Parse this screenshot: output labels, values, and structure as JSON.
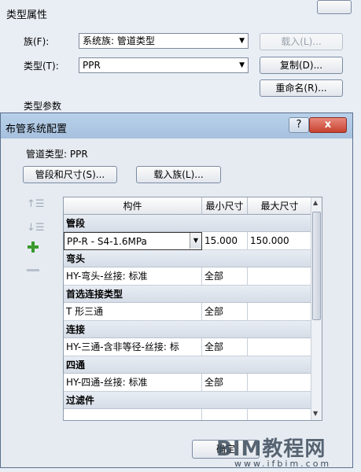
{
  "type_props": {
    "title": "类型属性",
    "family_label": "族(F):",
    "family_value": "系统族: 管道类型",
    "load_button": "载入(L)...",
    "type_label": "类型(T):",
    "type_value": "PPR",
    "duplicate_button": "复制(D)...",
    "rename_button": "重命名(R)...",
    "type_params_label": "类型参数"
  },
  "routing": {
    "title": "布管系统配置",
    "help": "?",
    "close": "x",
    "pipe_type_label": "管道类型: PPR",
    "segments_button": "管段和尺寸(S)...",
    "load_family_button": "载入族(L)...",
    "columns": [
      "构件",
      "最小尺寸",
      "最大尺寸"
    ],
    "rows": [
      {
        "group": "管段"
      },
      {
        "c1": "PP-R - S4-1.6MPa",
        "c2": "15.000",
        "c3": "150.000",
        "dropdown": true
      },
      {
        "group": "弯头"
      },
      {
        "c1": "HY-弯头-丝接: 标准",
        "c2": "全部",
        "c3": ""
      },
      {
        "group": "首选连接类型"
      },
      {
        "c1": "T 形三通",
        "c2": "全部",
        "c3": ""
      },
      {
        "group": "连接"
      },
      {
        "c1": "HY-三通-含非等径-丝接: 标",
        "c2": "全部",
        "c3": ""
      },
      {
        "group": "四通"
      },
      {
        "c1": "HY-四通-丝接: 标准",
        "c2": "全部",
        "c3": ""
      },
      {
        "group": "过滤件"
      }
    ],
    "ok_button": "确定"
  },
  "watermark": {
    "text": "BIM教程网",
    "url": "www.ifbim.com"
  }
}
